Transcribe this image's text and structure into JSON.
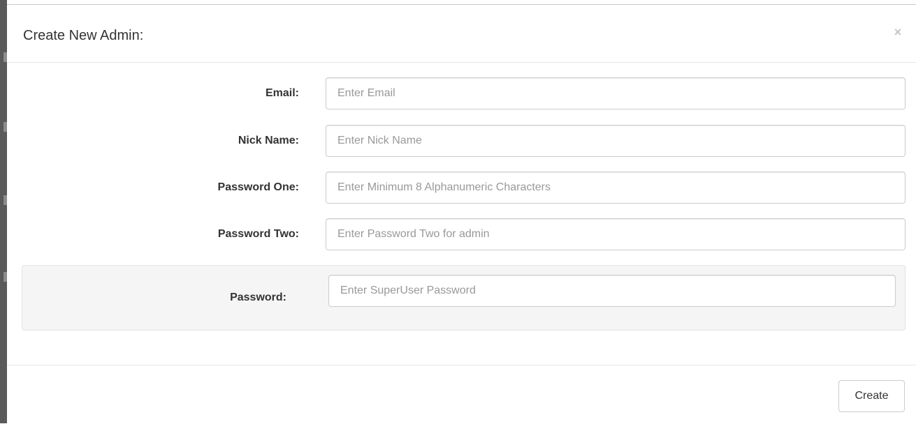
{
  "modal": {
    "title": "Create New Admin:",
    "close_symbol": "×",
    "close_icon": "close-icon"
  },
  "form": {
    "fields": [
      {
        "label": "Email:",
        "placeholder": "Enter Email",
        "value": ""
      },
      {
        "label": "Nick Name:",
        "placeholder": "Enter Nick Name",
        "value": ""
      },
      {
        "label": "Password One:",
        "placeholder": "Enter Minimum 8 Alphanumeric Characters",
        "value": ""
      },
      {
        "label": "Password Two:",
        "placeholder": "Enter Password Two for admin",
        "value": ""
      }
    ],
    "superuser": {
      "label": "Password:",
      "placeholder": "Enter SuperUser Password",
      "value": ""
    }
  },
  "footer": {
    "create_label": "Create"
  },
  "colors": {
    "label_text": "#333333",
    "placeholder_text": "#999999",
    "input_border": "#cccccc",
    "well_background": "#f5f5f5",
    "close_icon": "#c4c4c4"
  }
}
